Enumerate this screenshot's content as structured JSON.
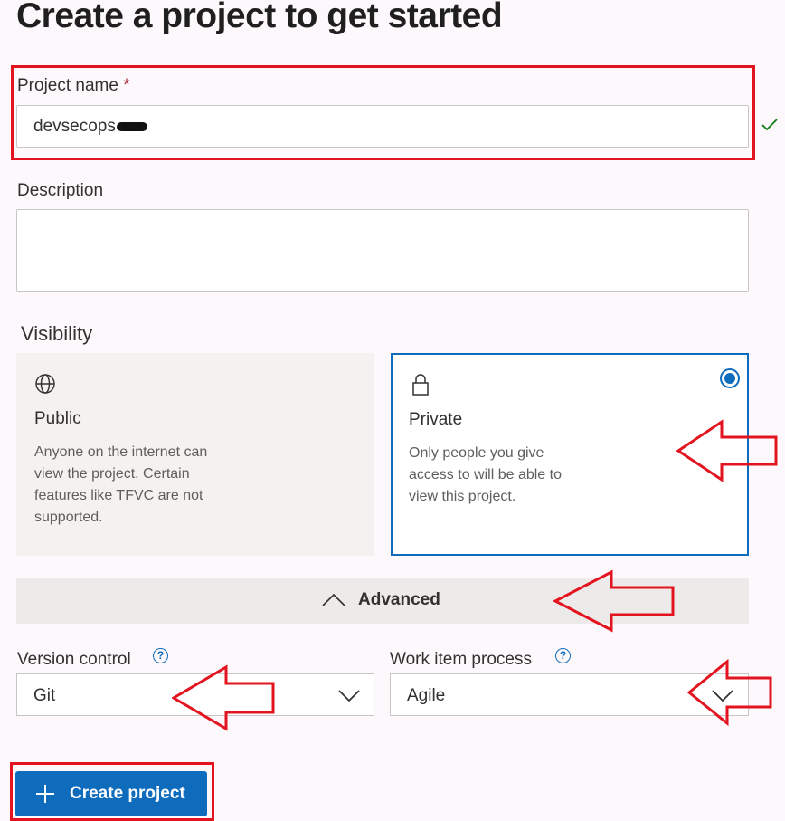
{
  "page": {
    "title": "Create a project to get started"
  },
  "form": {
    "project_name": {
      "label": "Project name",
      "required_mark": "*",
      "value": "devsecops",
      "status_icon": "checkmark-icon"
    },
    "description": {
      "label": "Description",
      "value": ""
    },
    "visibility": {
      "label": "Visibility",
      "options": [
        {
          "icon": "globe-icon",
          "title": "Public",
          "description": "Anyone on the internet can view the project. Certain features like TFVC are not supported.",
          "selected": false
        },
        {
          "icon": "lock-icon",
          "title": "Private",
          "description": "Only people you give access to will be able to view this project.",
          "selected": true
        }
      ]
    },
    "advanced": {
      "label": "Advanced",
      "expanded": true,
      "icon": "chevron-up-icon"
    },
    "version_control": {
      "label": "Version control",
      "value": "Git",
      "help_icon": "question-icon"
    },
    "work_item_process": {
      "label": "Work item process",
      "value": "Agile",
      "help_icon": "question-icon"
    },
    "submit": {
      "label": "Create project",
      "icon": "plus-icon"
    }
  },
  "annotations": {
    "highlight_color": "#e3141f",
    "accent_color": "#0f6cbd"
  }
}
